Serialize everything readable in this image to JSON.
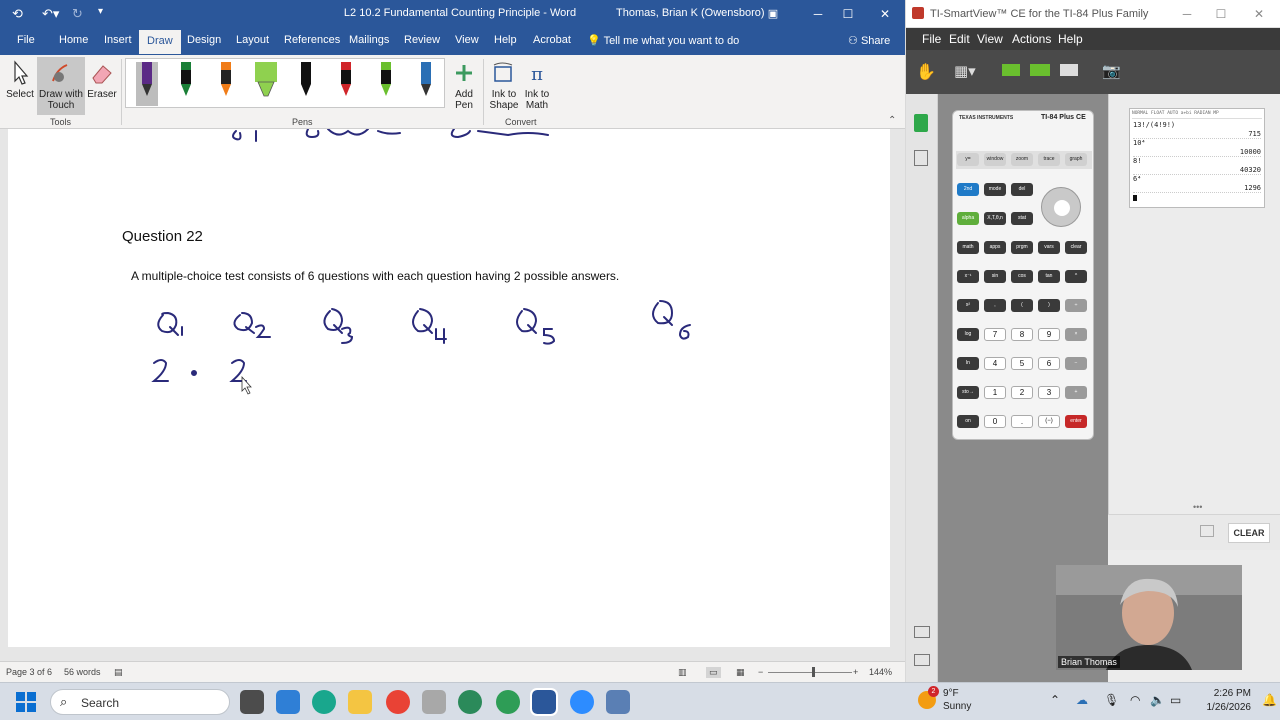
{
  "word": {
    "title": "L2 10.2 Fundamental Counting Principle  -  Word",
    "user": "Thomas, Brian K (Owensboro)",
    "menu": [
      "File",
      "Home",
      "Insert",
      "Draw",
      "Design",
      "Layout",
      "References",
      "Mailings",
      "Review",
      "View",
      "Help",
      "Acrobat"
    ],
    "active_tab": "Draw",
    "tell_me": "Tell me what you want to do",
    "share": "Share",
    "ribbon": {
      "select": "Select",
      "draw_with_touch": "Draw with Touch",
      "eraser": "Eraser",
      "tools_label": "Tools",
      "pens_label": "Pens",
      "add_pen": "Add Pen",
      "ink_to_shape": "Ink to Shape",
      "ink_to_math": "Ink to Math",
      "convert_label": "Convert",
      "pen_colors": [
        "#5b2a86",
        "#1a7f37",
        "#f07c18",
        "#8fd14f",
        "#111111",
        "#d0252a",
        "#6abf2e",
        "#2a6fb5"
      ]
    },
    "document": {
      "question_heading": "Question 22",
      "question_text": "A multiple-choice test consists of 6 questions with each question having 2 possible answers.",
      "ink_color": "#2a2a7a"
    },
    "status": {
      "page": "Page 3 of 6",
      "words": "56 words",
      "zoom": "144%"
    }
  },
  "ti": {
    "title": "TI-SmartView™ CE for the TI-84 Plus Family",
    "menu": [
      "File",
      "Edit",
      "View",
      "Actions",
      "Help"
    ],
    "calc_brand": "TEXAS INSTRUMENTS",
    "calc_model": "TI-84 Plus CE",
    "screen_status": "NORMAL FLOAT AUTO a+bi RADIAN MP",
    "history": [
      {
        "expr": "13!/(4!9!)",
        "result": "715"
      },
      {
        "expr": "10⁴",
        "result": "10000"
      },
      {
        "expr": "8!",
        "result": "40320"
      },
      {
        "expr": "6⁴",
        "result": "1296"
      }
    ],
    "clear": "CLEAR",
    "keys": {
      "row1": [
        "y=",
        "window",
        "zoom",
        "trace",
        "graph"
      ],
      "row2": [
        "2nd",
        "mode",
        "del"
      ],
      "row3": [
        "alpha",
        "X,T,θ,n",
        "stat"
      ],
      "row4": [
        "math",
        "apps",
        "prgm",
        "vars",
        "clear"
      ],
      "row5": [
        "x⁻¹",
        "sin",
        "cos",
        "tan",
        "^"
      ],
      "row6": [
        "x²",
        ",",
        "(",
        ")",
        "÷"
      ],
      "row7": [
        "log",
        "7",
        "8",
        "9",
        "×"
      ],
      "row8": [
        "ln",
        "4",
        "5",
        "6",
        "−"
      ],
      "row9": [
        "sto→",
        "1",
        "2",
        "3",
        "+"
      ],
      "row10": [
        "on",
        "0",
        ".",
        "(−)",
        "enter"
      ]
    }
  },
  "webcam": {
    "name": "Brian Thomas"
  },
  "taskbar": {
    "search": "Search",
    "weather_temp": "9°F",
    "weather_desc": "Sunny",
    "time": "2:26 PM",
    "date": "1/26/2026",
    "notification_count": "2"
  }
}
